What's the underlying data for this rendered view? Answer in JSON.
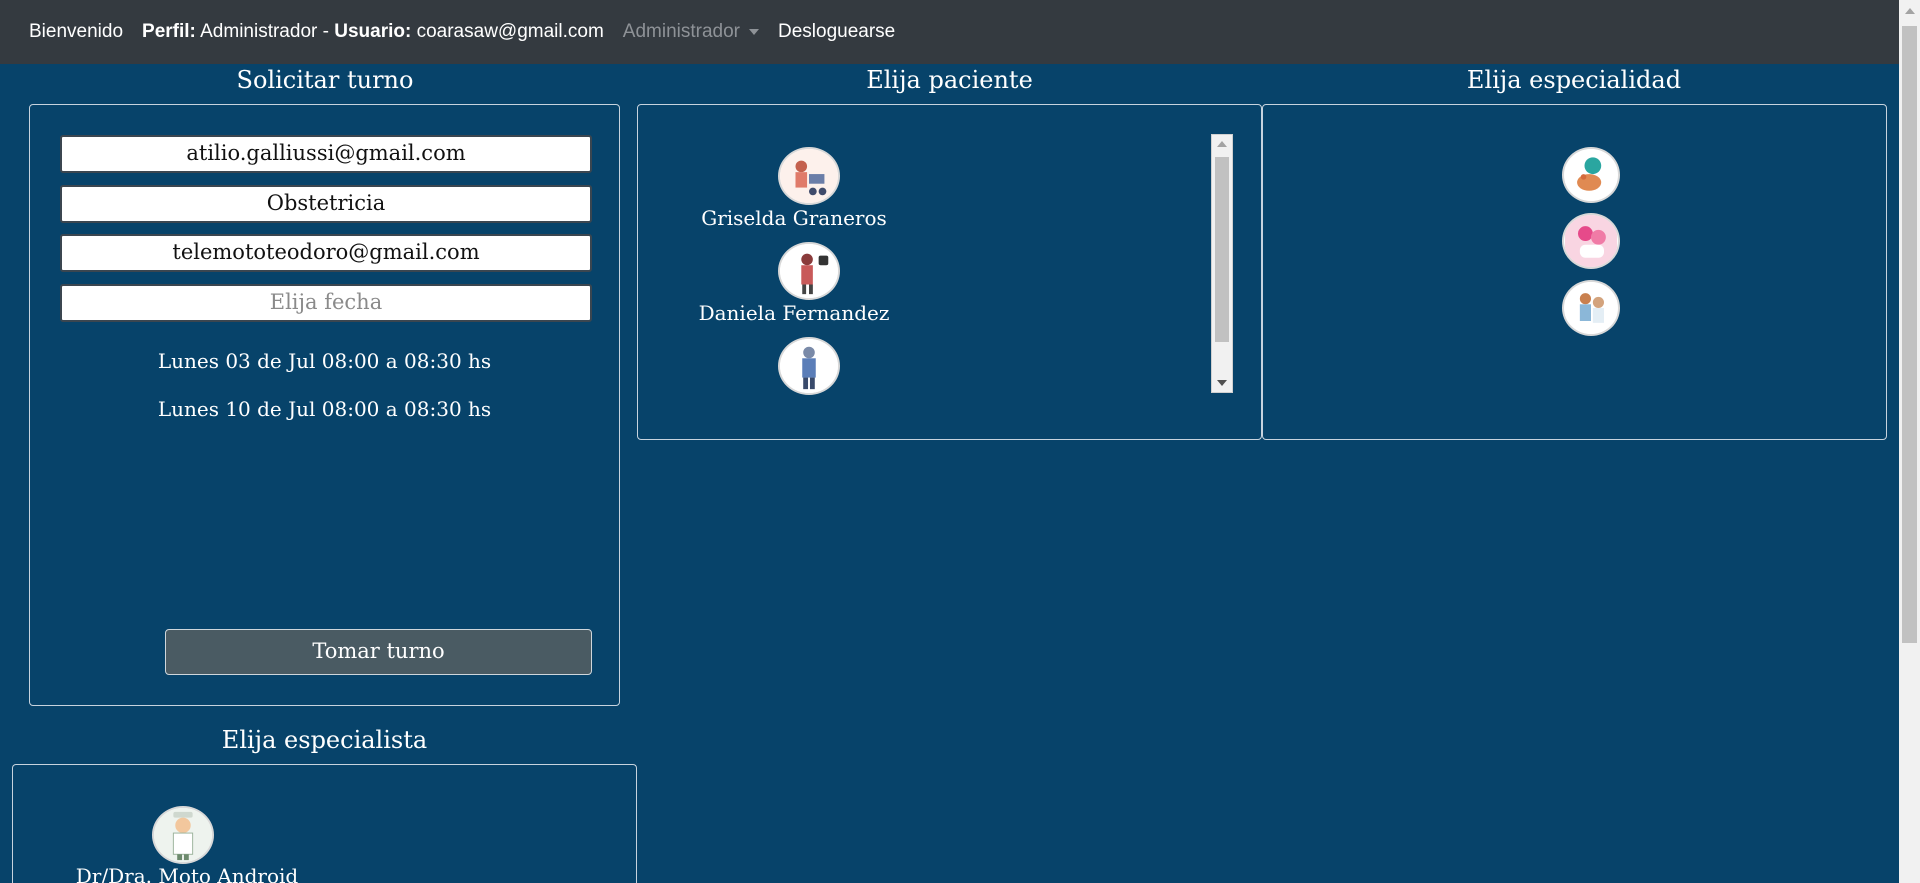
{
  "navbar": {
    "welcome": "Bienvenido",
    "profile_label": "Perfil:",
    "profile_value": "Administrador -",
    "user_label": "Usuario:",
    "user_value": "coarasaw@gmail.com",
    "admin_menu": "Administrador",
    "logout": "Desloguearse"
  },
  "solicitar": {
    "title": "Solicitar turno",
    "patient_field": "atilio.galliussi@gmail.com",
    "specialty_field": "Obstetricia",
    "specialist_field": "telemototeodoro@gmail.com",
    "date_placeholder": "Elija fecha",
    "slots": [
      "Lunes 03 de Jul 08:00 a 08:30 hs",
      "Lunes 10 de Jul 08:00 a 08:30 hs"
    ],
    "submit_label": "Tomar turno"
  },
  "pacientes": {
    "title": "Elija paciente",
    "items": [
      {
        "name": "Griselda Graneros",
        "icon": "patient-avatar-icon"
      },
      {
        "name": "Daniela Fernandez",
        "icon": "patient-avatar-icon"
      },
      {
        "name": "",
        "icon": "patient-avatar-icon"
      }
    ]
  },
  "especialidades": {
    "title": "Elija especialidad",
    "items": [
      {
        "icon": "specialty-avatar-icon"
      },
      {
        "icon": "specialty-avatar-icon"
      },
      {
        "icon": "specialty-avatar-icon"
      }
    ]
  },
  "especialistas": {
    "title": "Elija especialista",
    "items": [
      {
        "name": "Dr/Dra. Moto Android",
        "icon": "doctor-avatar-icon"
      }
    ]
  },
  "colors": {
    "background": "#07436a",
    "navbar": "#343a40",
    "button": "#4a5b63"
  }
}
